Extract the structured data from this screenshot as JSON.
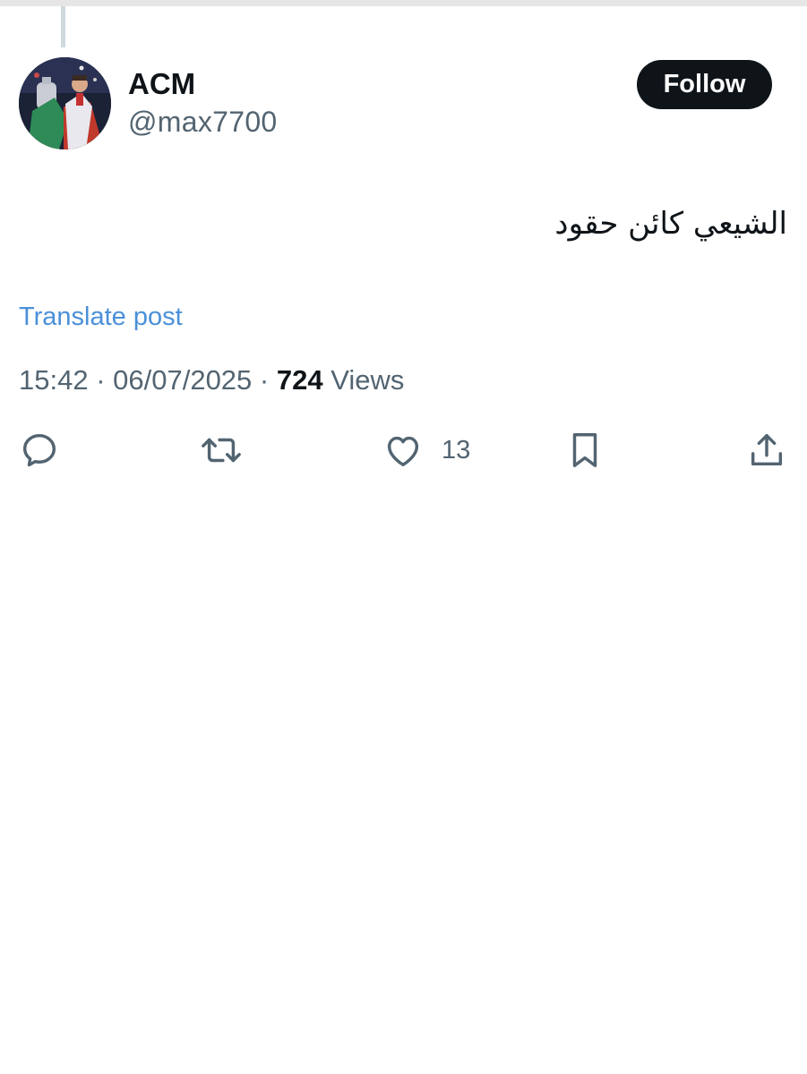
{
  "author": {
    "display_name": "ACM",
    "handle": "@max7700",
    "avatar_icon": "profile-photo-trophy"
  },
  "follow_button": {
    "label": "Follow"
  },
  "post": {
    "text": "الشيعي كائن حقود",
    "translate_label": "Translate post"
  },
  "meta": {
    "time": "15:42",
    "separator": "·",
    "date": "06/07/2025",
    "views_count": "724",
    "views_label": "Views"
  },
  "actions": {
    "reply_icon": "reply-icon",
    "repost_icon": "repost-icon",
    "like_icon": "heart-icon",
    "like_count": "13",
    "bookmark_icon": "bookmark-icon",
    "share_icon": "share-icon"
  },
  "colors": {
    "text_primary": "#0f1419",
    "text_secondary": "#536471",
    "link": "#4a90d9",
    "button_bg": "#0f1419"
  }
}
